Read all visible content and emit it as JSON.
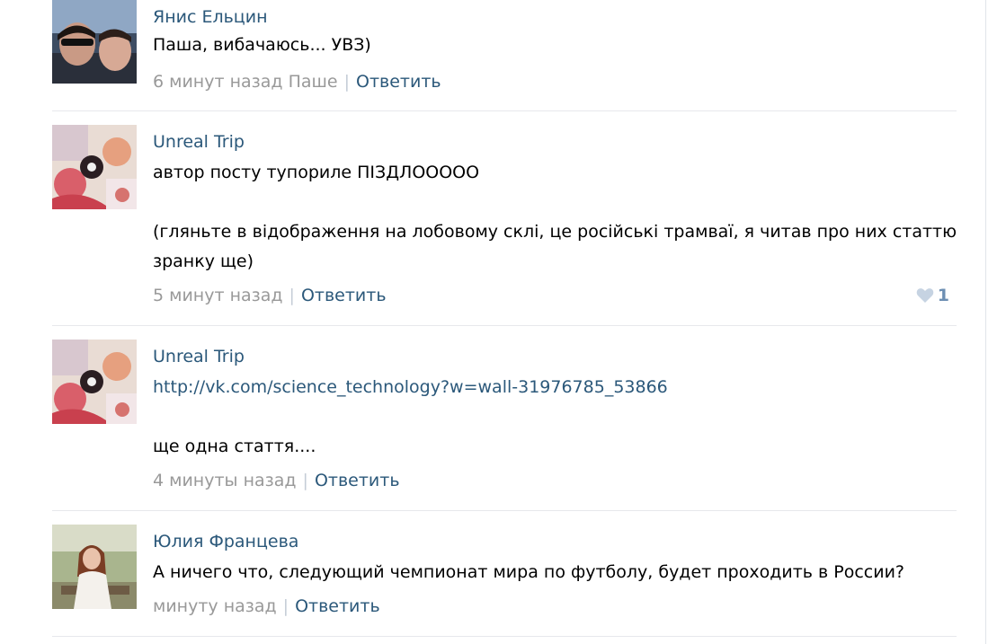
{
  "comments": [
    {
      "author": "Янис Ельцин",
      "text_lines": [
        "Паша, вибачаюсь... УВЗ)"
      ],
      "time": "6 минут назад",
      "reply_to": "Паше",
      "reply_label": "Ответить"
    },
    {
      "author": "Unreal Trip",
      "text_lines": [
        "автор посту тупориле ПІЗДЛООООО",
        "",
        "(гляньте в відображення на лобовому склі, це російські трамваї, я читав про них статтю",
        "зранку ще)"
      ],
      "time": "5 минут назад",
      "reply_label": "Ответить",
      "likes": "1"
    },
    {
      "author": "Unreal Trip",
      "link": "http://vk.com/science_technology?w=wall-31976785_53866",
      "text_lines": [
        "",
        "ще одна стаття...."
      ],
      "time": "4 минуты назад",
      "reply_label": "Ответить"
    },
    {
      "author": "Юлия Францева",
      "text_lines": [
        "А ничего что, следующий чемпионат мира по футболу, будет проходить в России?"
      ],
      "time": "минуту назад",
      "reply_label": "Ответить"
    }
  ],
  "colors": {
    "link": "#2b587a",
    "meta": "#999999",
    "like": "#6d8fb3",
    "divider": "#e7e8ec"
  },
  "icons": {
    "like": "heart-icon"
  }
}
